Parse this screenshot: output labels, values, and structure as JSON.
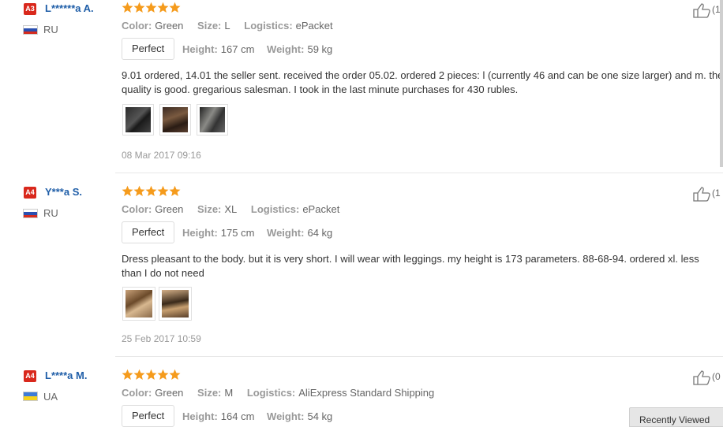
{
  "colors": {
    "star": "#f59b1c",
    "badge": "#d9281c",
    "username": "#1f5ea8"
  },
  "labels": {
    "color": "Color:",
    "size": "Size:",
    "logistics": "Logistics:",
    "height": "Height:",
    "weight": "Weight:"
  },
  "reviews": [
    {
      "badge": "A3",
      "username": "L******a A.",
      "country": "RU",
      "rating": 5,
      "color": "Green",
      "size": "L",
      "logistics": "ePacket",
      "fit": "Perfect",
      "height": "167 cm",
      "weight": "59 kg",
      "text": "9.01 ordered, 14.01 the seller sent. received the order 05.02. ordered 2 pieces: l (currently 46 and can be one size larger) and m. the quality is good. gregarious salesman. I took in the last minute purchases for 430 rubles.",
      "photos": 3,
      "date": "08 Mar 2017 09:16",
      "likes": "(1"
    },
    {
      "badge": "A4",
      "username": "Y***a S.",
      "country": "RU",
      "rating": 5,
      "color": "Green",
      "size": "XL",
      "logistics": "ePacket",
      "fit": "Perfect",
      "height": "175 cm",
      "weight": "64 kg",
      "text": "Dress pleasant to the body. but it is very short. I will wear with leggings. my height is 173 parameters. 88-68-94. ordered xl. less than I do not need",
      "photos": 2,
      "date": "25 Feb 2017 10:59",
      "likes": "(1"
    },
    {
      "badge": "A4",
      "username": "L****a M.",
      "country": "UA",
      "rating": 5,
      "color": "Green",
      "size": "M",
      "logistics": "AliExpress Standard Shipping",
      "fit": "Perfect",
      "height": "164 cm",
      "weight": "54 kg",
      "likes": "(0"
    }
  ],
  "recently_viewed": "Recently Viewed"
}
